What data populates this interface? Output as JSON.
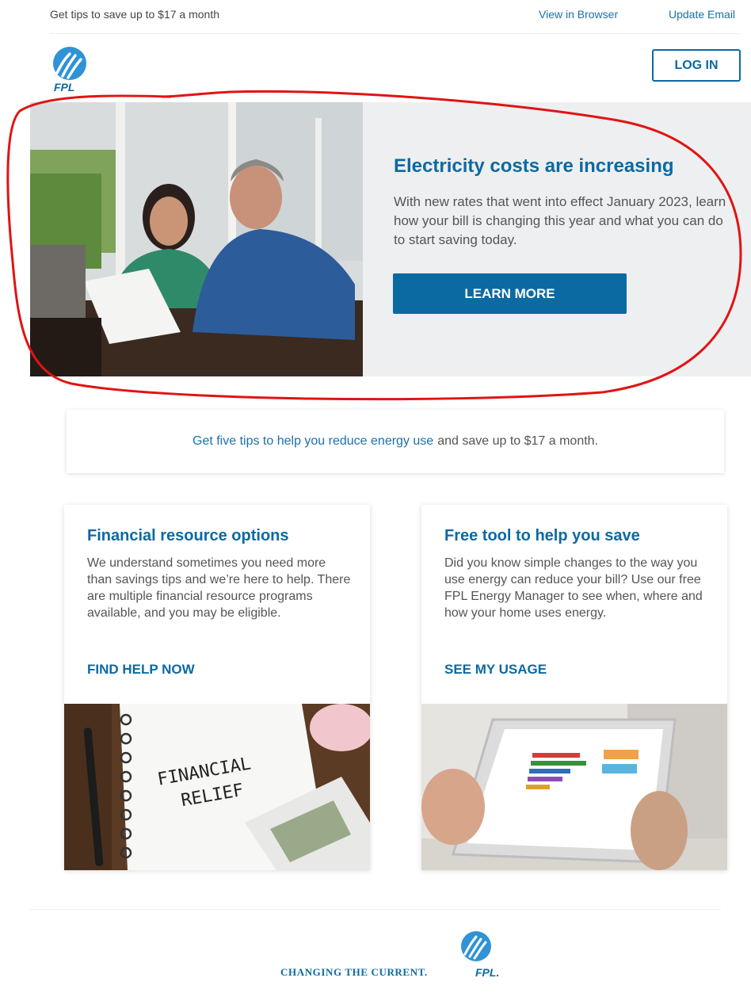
{
  "preheader": {
    "tip": "Get tips to save up to $17 a month",
    "view_in_browser": "View in Browser",
    "update_email": "Update Email"
  },
  "brand": {
    "logo_text": "FPL",
    "color": "#0b6aa2"
  },
  "header": {
    "login_label": "LOG IN"
  },
  "hero": {
    "title": "Electricity costs are increasing",
    "body": "With new rates that went into effect January 2023, learn how your bill is changing this year and what you can do to start saving today.",
    "cta": "LEARN MORE"
  },
  "tips": {
    "link_text": "Get five tips to help you reduce energy use",
    "trailing_text": "and save up to $17 a month."
  },
  "cards": [
    {
      "title": "Financial resource options",
      "body": "We understand sometimes you need more than savings tips and we’re here to help. There are multiple financial resource programs available, and you may be eligible.",
      "cta": "FIND HELP NOW",
      "image_text_line1": "FINANCIAL",
      "image_text_line2": "RELIEF"
    },
    {
      "title": "Free tool to help you save",
      "body": "Did you know simple changes to the way you use energy can reduce your bill? Use our free FPL Energy Manager to see when, where and how your home uses energy.",
      "cta": "SEE MY USAGE"
    }
  ],
  "footer": {
    "tagline": "CHANGING THE CURRENT.",
    "logo_text": "FPL."
  },
  "colors": {
    "accent": "#0b6aa2",
    "annotation": "#e01414",
    "hero_bg": "#eeeff0"
  }
}
